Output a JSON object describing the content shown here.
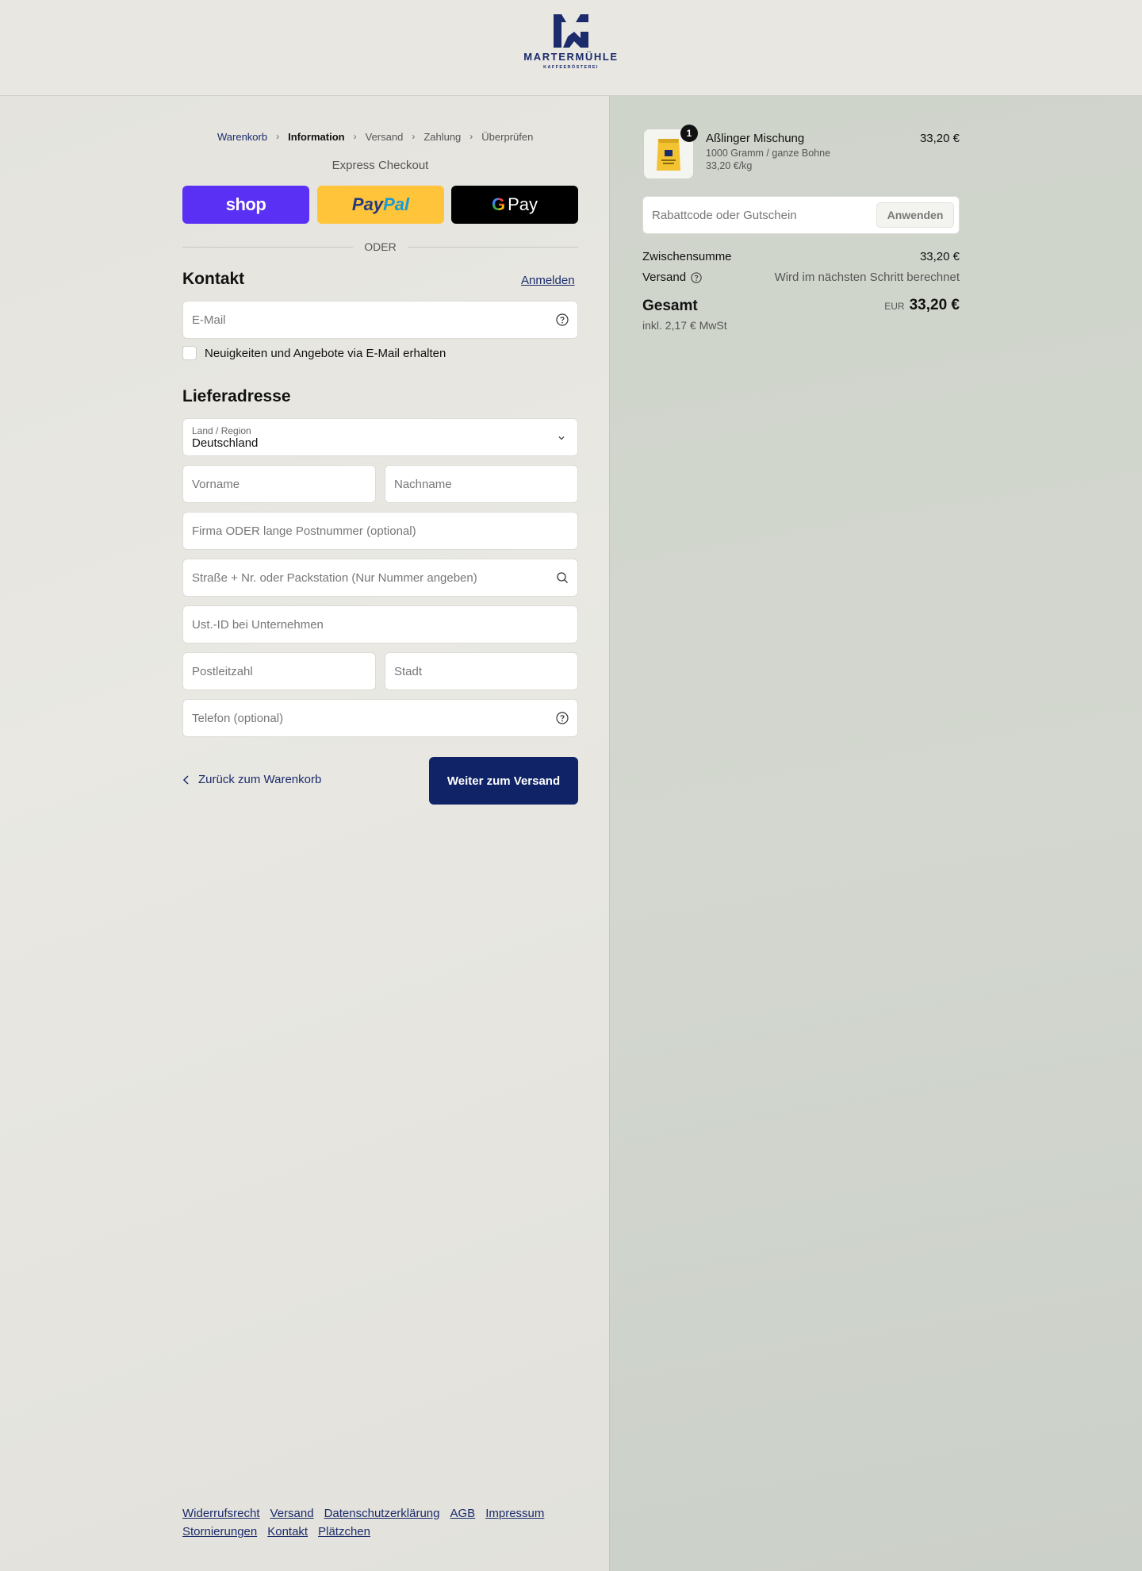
{
  "brand": {
    "name": "MARTERMÜHLE",
    "tagline": "KAFFEERÖSTEREI",
    "color": "#1b2b6b"
  },
  "breadcrumb": [
    {
      "label": "Warenkorb",
      "state": "link"
    },
    {
      "label": "Information",
      "state": "current"
    },
    {
      "label": "Versand",
      "state": "upcoming"
    },
    {
      "label": "Zahlung",
      "state": "upcoming"
    },
    {
      "label": "Überprüfen",
      "state": "upcoming"
    }
  ],
  "express": {
    "title": "Express Checkout",
    "shop_label": "shop",
    "paypal_pay": "Pay",
    "paypal_pal": "Pal",
    "gpay_g": "G",
    "gpay_label": "Pay",
    "divider": "ODER"
  },
  "contact": {
    "title": "Kontakt",
    "login_label": "Anmelden",
    "email_placeholder": "E-Mail",
    "newsletter_label": "Neuigkeiten und Angebote via E-Mail erhalten"
  },
  "shipping": {
    "title": "Lieferadresse",
    "country_label": "Land / Region",
    "country_value": "Deutschland",
    "first_name_placeholder": "Vorname",
    "last_name_placeholder": "Nachname",
    "company_placeholder": "Firma ODER lange Postnummer (optional)",
    "street_placeholder": "Straße + Nr. oder Packstation (Nur Nummer angeben)",
    "vat_placeholder": "Ust.-ID bei Unternehmen",
    "zip_placeholder": "Postleitzahl",
    "city_placeholder": "Stadt",
    "phone_placeholder": "Telefon (optional)"
  },
  "actions": {
    "back_label": "Zurück zum Warenkorb",
    "continue_label": "Weiter zum Versand",
    "continue_color": "#0f2366"
  },
  "footer": {
    "links": [
      "Widerrufsrecht",
      "Versand",
      "Datenschutzerklärung",
      "AGB",
      "Impressum",
      "Stornierungen",
      "Kontakt",
      "Plätzchen"
    ]
  },
  "order": {
    "product": {
      "quantity": "1",
      "name": "Aßlinger Mischung",
      "variant": "1000 Gramm / ganze Bohne",
      "unit_price": "33,20 €/kg",
      "price": "33,20 €"
    },
    "discount_placeholder": "Rabattcode oder Gutschein",
    "apply_label": "Anwenden",
    "subtotal_label": "Zwischensumme",
    "subtotal_value": "33,20 €",
    "shipping_label": "Versand",
    "shipping_value": "Wird im nächsten Schritt berechnet",
    "total_label": "Gesamt",
    "total_currency": "EUR",
    "total_value": "33,20 €",
    "tax_note": "inkl. 2,17 € MwSt"
  }
}
